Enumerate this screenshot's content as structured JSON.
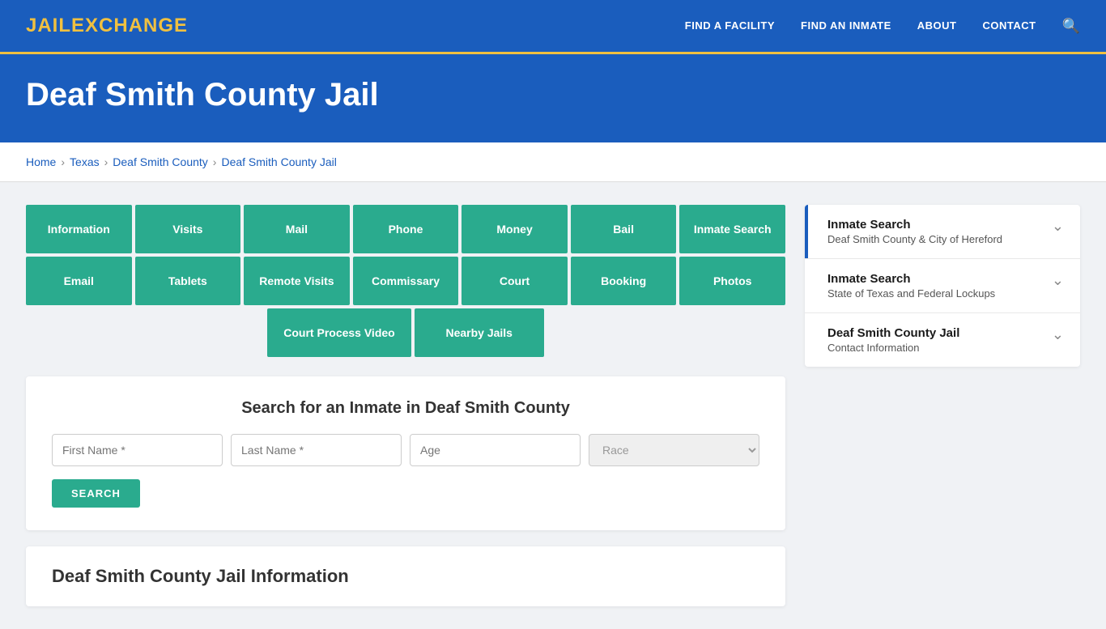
{
  "logo": {
    "part1": "JAIL",
    "part2": "E",
    "part3": "XCHANGE"
  },
  "nav": {
    "links": [
      {
        "label": "FIND A FACILITY",
        "href": "#"
      },
      {
        "label": "FIND AN INMATE",
        "href": "#"
      },
      {
        "label": "ABOUT",
        "href": "#"
      },
      {
        "label": "CONTACT",
        "href": "#"
      }
    ]
  },
  "hero": {
    "title": "Deaf Smith County Jail"
  },
  "breadcrumb": {
    "items": [
      "Home",
      "Texas",
      "Deaf Smith County",
      "Deaf Smith County Jail"
    ]
  },
  "buttons_row1": [
    "Information",
    "Visits",
    "Mail",
    "Phone",
    "Money",
    "Bail",
    "Inmate Search"
  ],
  "buttons_row2": [
    "Email",
    "Tablets",
    "Remote Visits",
    "Commissary",
    "Court",
    "Booking",
    "Photos"
  ],
  "buttons_row3": [
    "Court Process Video",
    "Nearby Jails"
  ],
  "search": {
    "title": "Search for an Inmate in Deaf Smith County",
    "first_name_placeholder": "First Name *",
    "last_name_placeholder": "Last Name *",
    "age_placeholder": "Age",
    "race_placeholder": "Race",
    "button_label": "SEARCH"
  },
  "info_section": {
    "title": "Deaf Smith County Jail Information"
  },
  "sidebar": {
    "items": [
      {
        "title": "Inmate Search",
        "subtitle": "Deaf Smith County & City of Hereford",
        "accent": true
      },
      {
        "title": "Inmate Search",
        "subtitle": "State of Texas and Federal Lockups",
        "accent": false
      },
      {
        "title": "Deaf Smith County Jail",
        "subtitle": "Contact Information",
        "accent": false
      }
    ]
  }
}
